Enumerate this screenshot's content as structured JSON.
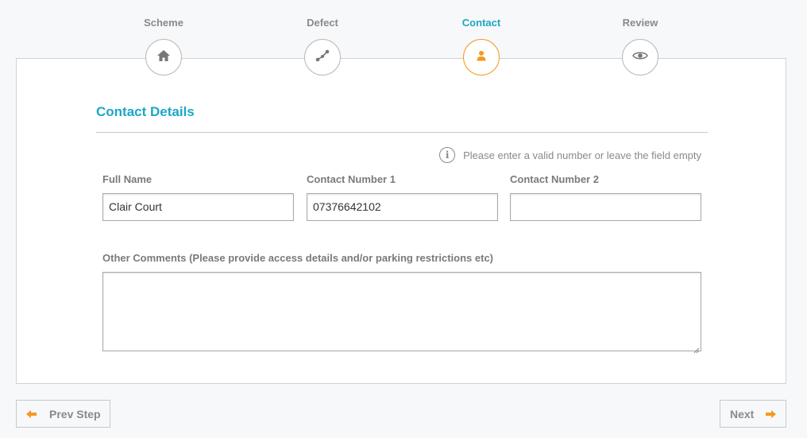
{
  "steps": [
    {
      "label": "Scheme",
      "icon": "home-icon"
    },
    {
      "label": "Defect",
      "icon": "route-icon"
    },
    {
      "label": "Contact",
      "icon": "user-icon"
    },
    {
      "label": "Review",
      "icon": "eye-icon"
    }
  ],
  "colors": {
    "accent": "#1ba7c4",
    "active_step_border": "#f39a1f",
    "arrow": "#f39a1f"
  },
  "section": {
    "title": "Contact Details"
  },
  "hint": {
    "icon": "info-icon",
    "text": "Please enter a valid number or leave the field empty"
  },
  "fields": {
    "full_name": {
      "label": "Full Name",
      "value": "Clair Court"
    },
    "contact_1": {
      "label": "Contact Number 1",
      "value": "07376642102"
    },
    "contact_2": {
      "label": "Contact Number 2",
      "value": ""
    }
  },
  "comments": {
    "label": "Other Comments (Please provide access details and/or parking restrictions etc)",
    "value": ""
  },
  "nav": {
    "prev_label": "Prev Step",
    "next_label": "Next"
  }
}
